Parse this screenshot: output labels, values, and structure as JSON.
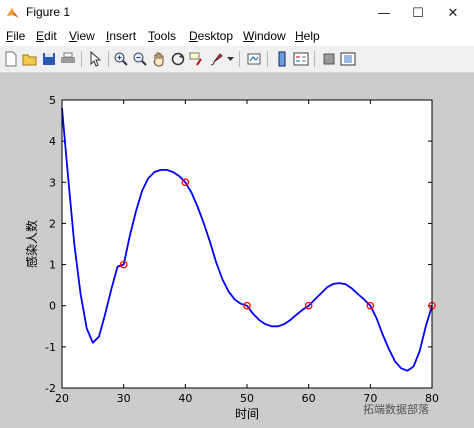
{
  "window": {
    "title": "Figure 1",
    "minimize_glyph": "—",
    "maximize_glyph": "☐",
    "close_glyph": "✕"
  },
  "menu": {
    "items": [
      {
        "label": "File",
        "accel": "F"
      },
      {
        "label": "Edit",
        "accel": "E"
      },
      {
        "label": "View",
        "accel": "V"
      },
      {
        "label": "Insert",
        "accel": "I"
      },
      {
        "label": "Tools",
        "accel": "T"
      },
      {
        "label": "Desktop",
        "accel": "D"
      },
      {
        "label": "Window",
        "accel": "W"
      },
      {
        "label": "Help",
        "accel": "H"
      }
    ]
  },
  "toolbar": {
    "icons": [
      "new-figure-icon",
      "open-file-icon",
      "save-icon",
      "print-icon",
      "select-arrow-icon",
      "zoom-in-icon",
      "zoom-out-icon",
      "pan-hand-icon",
      "rotate-3d-icon",
      "data-cursor-icon",
      "brush-icon",
      "brush-dropdown-icon",
      "link-plot-icon",
      "colorbar-icon",
      "legend-icon",
      "hide-plot-tools-icon",
      "show-plot-tools-icon"
    ]
  },
  "watermark": "拓端数据部落",
  "chart_data": {
    "type": "line",
    "xlabel": "时间",
    "ylabel": "感染人数",
    "xlim": [
      20,
      80
    ],
    "ylim": [
      -2,
      5
    ],
    "xticks": [
      20,
      30,
      40,
      50,
      60,
      70,
      80
    ],
    "yticks": [
      -2,
      -1,
      0,
      1,
      2,
      3,
      4,
      5
    ],
    "grid": false,
    "series": [
      {
        "style": "solid line",
        "color": "#0000ff",
        "x": [
          20,
          21,
          22,
          23,
          24,
          25,
          26,
          27,
          28,
          29,
          30,
          31,
          32,
          33,
          34,
          35,
          36,
          37,
          38,
          39,
          40,
          41,
          42,
          43,
          44,
          45,
          46,
          47,
          48,
          49,
          50,
          51,
          52,
          53,
          54,
          55,
          56,
          57,
          58,
          59,
          60,
          61,
          62,
          63,
          64,
          65,
          66,
          67,
          68,
          69,
          70,
          71,
          72,
          73,
          74,
          75,
          76,
          77,
          78,
          79,
          80
        ],
        "y": [
          4.8,
          3.1,
          1.5,
          0.3,
          -0.55,
          -0.9,
          -0.75,
          -0.2,
          0.4,
          0.95,
          1.0,
          1.7,
          2.3,
          2.8,
          3.1,
          3.25,
          3.3,
          3.3,
          3.25,
          3.15,
          3.0,
          2.75,
          2.4,
          2.0,
          1.55,
          1.05,
          0.65,
          0.35,
          0.15,
          0.05,
          0.0,
          -0.2,
          -0.35,
          -0.45,
          -0.5,
          -0.5,
          -0.45,
          -0.35,
          -0.22,
          -0.1,
          0.0,
          0.15,
          0.3,
          0.45,
          0.53,
          0.55,
          0.52,
          0.42,
          0.28,
          0.15,
          0.0,
          -0.3,
          -0.7,
          -1.05,
          -1.35,
          -1.52,
          -1.58,
          -1.48,
          -1.1,
          -0.5,
          0.0
        ]
      },
      {
        "style": "red circle markers",
        "color": "#ff0000",
        "x": [
          30,
          40,
          50,
          60,
          70,
          80
        ],
        "y": [
          1,
          3,
          0,
          0,
          0,
          0
        ]
      }
    ]
  }
}
